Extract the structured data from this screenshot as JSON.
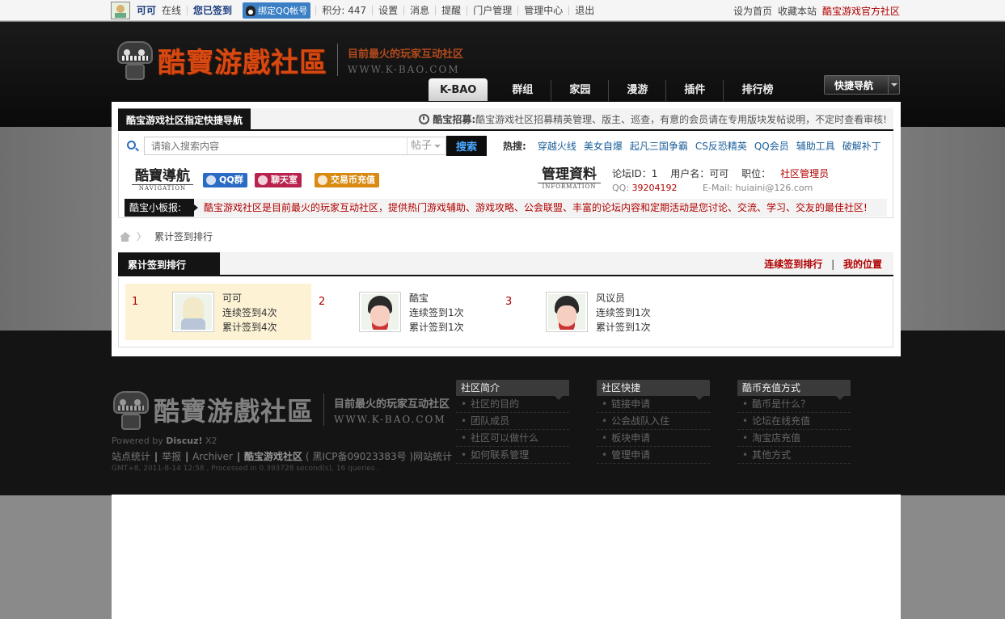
{
  "topbar": {
    "username": "可可",
    "online": "在线",
    "signed": "您已签到",
    "qq_bind": "绑定QQ帐号",
    "points": "积分: 447",
    "links": [
      "设置",
      "消息",
      "提醒",
      "门户管理",
      "管理中心",
      "退出"
    ],
    "right": [
      "设为首页",
      "收藏本站"
    ],
    "right_official": "酷宝游戏官方社区"
  },
  "header": {
    "logo_text": "酷寶游戲社區",
    "slogan": "目前最火的玩家互动社区",
    "slogan_url": "WWW.K-BAO.COM",
    "nav": [
      "K-BAO",
      "群组",
      "家园",
      "漫游",
      "插件",
      "排行榜"
    ],
    "quick_nav": "快捷导航"
  },
  "quickbar": {
    "title": "酷宝游戏社区指定快捷导航",
    "notice_label": "酷宝招募:",
    "notice_text": "酷宝游戏社区招募精英管理、版主、巡查，有意的会员请在专用版块发帖说明，不定时查看审核!"
  },
  "search": {
    "placeholder": "请输入搜索内容",
    "type": "帖子",
    "button": "搜索",
    "hot_label": "热搜:",
    "hot": [
      "穿越火线",
      "美女自爆",
      "起凡三国争霸",
      "CS反恐精英",
      "QQ会员",
      "辅助工具",
      "破解补丁"
    ]
  },
  "info": {
    "nav_logo_big": "酷寶導航",
    "nav_logo_small": "NAVIGATION",
    "pills": [
      "QQ群",
      "聊天室",
      "交易币充值"
    ],
    "mgr_logo_big": "管理資料",
    "mgr_logo_small": "INFORMATION",
    "forum_id": "论坛ID：1",
    "user_name": "用户名：可可",
    "position_label": "职位：",
    "position": "社区管理员",
    "qq_label": "QQ:",
    "qq": "39204192",
    "email": "E-Mail: huiaini@126.com"
  },
  "ticker": {
    "label": "酷宝小板报:",
    "text": "酷宝游戏社区是目前最火的玩家互动社区，提供热门游戏辅助、游戏攻略、公会联盟、丰富的论坛内容和定期活动是您讨论、交流、学习、交友的最佳社区!"
  },
  "breadcrumb": {
    "current": "累计签到排行"
  },
  "ranking": {
    "title": "累计签到排行",
    "link1": "连续签到排行",
    "sep": "|",
    "link2": "我的位置",
    "items": [
      {
        "rank": "1",
        "name": "可可",
        "continuous": "连续签到4次",
        "total": "累计签到4次"
      },
      {
        "rank": "2",
        "name": "酷宝",
        "continuous": "连续签到1次",
        "total": "累计签到1次"
      },
      {
        "rank": "3",
        "name": "风议员",
        "continuous": "连续签到1次",
        "total": "累计签到1次"
      }
    ]
  },
  "footer": {
    "powered": "Powered by ",
    "powered_brand": "Discuz!",
    "powered_ver": " X2",
    "links": [
      "站点统计",
      "举报",
      "Archiver"
    ],
    "site": "酷宝游戏社区",
    "icp": "( 黑ICP备09023383号 )网站统计",
    "gmt": "GMT+8, 2011-8-14 12:58 , Processed in 0.393728 second(s), 16 queries .",
    "cols": [
      {
        "title": "社区简介",
        "items": [
          "社区的目的",
          "团队成员",
          "社区可以做什么",
          "如何联系管理"
        ]
      },
      {
        "title": "社区快捷",
        "items": [
          "链接申请",
          "公会战队入住",
          "板块申请",
          "管理申请"
        ]
      },
      {
        "title": "酷币充值方式",
        "items": [
          "酷币是什么？",
          "论坛在线充值",
          "淘宝店充值",
          "其他方式"
        ]
      }
    ]
  }
}
